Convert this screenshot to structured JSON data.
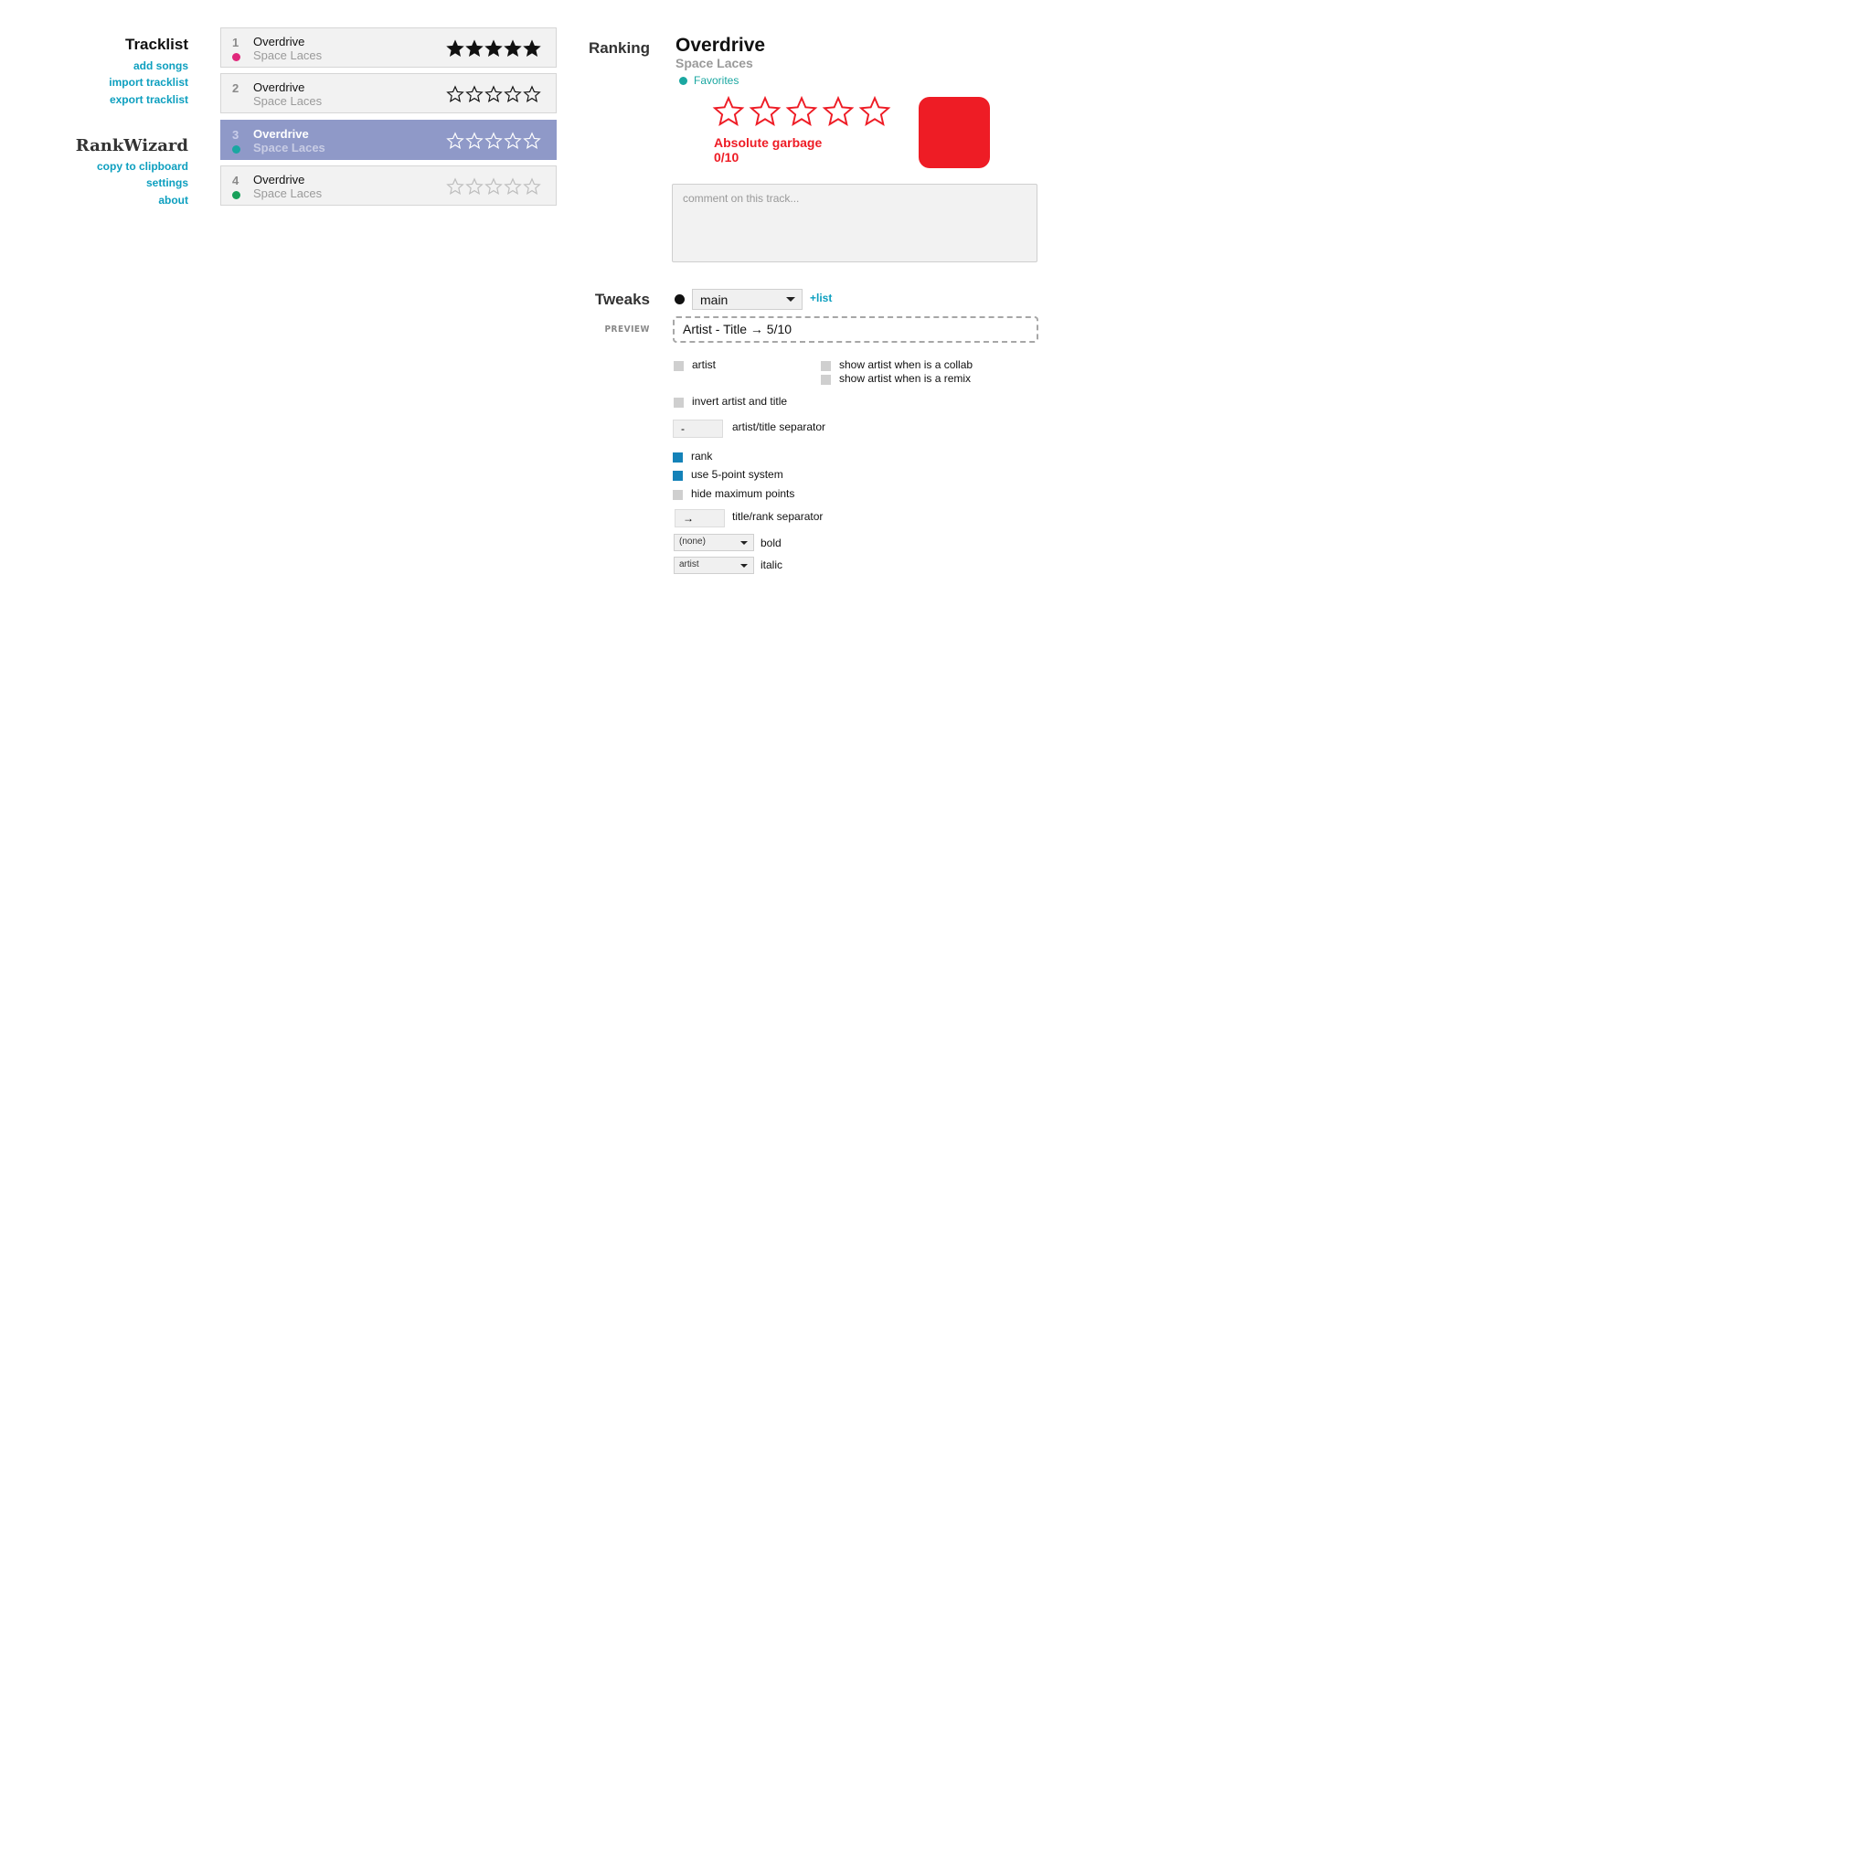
{
  "sidebar": {
    "tracklist_title": "Tracklist",
    "tracklist_links": [
      "add songs",
      "import tracklist",
      "export tracklist"
    ],
    "app_name": "RankWizard",
    "app_links": [
      "copy to clipboard",
      "settings",
      "about"
    ]
  },
  "tracks": [
    {
      "num": "1",
      "title": "Overdrive",
      "artist": "Space Laces",
      "dot_color": "#e0277b",
      "stars_filled": 5,
      "star_style": "filled"
    },
    {
      "num": "2",
      "title": "Overdrive",
      "artist": "Space Laces",
      "dot_color": "",
      "stars_filled": 0,
      "star_style": "outline"
    },
    {
      "num": "3",
      "title": "Overdrive",
      "artist": "Space Laces",
      "dot_color": "#1aa7a1",
      "stars_filled": 0,
      "star_style": "white-outline",
      "selected": true
    },
    {
      "num": "4",
      "title": "Overdrive",
      "artist": "Space Laces",
      "dot_color": "#18a05a",
      "stars_filled": 0,
      "star_style": "faint"
    }
  ],
  "ranking": {
    "label": "Ranking",
    "title": "Overdrive",
    "artist": "Space Laces",
    "list_name": "Favorites",
    "list_color": "#1aa7a1",
    "stars_total": 5,
    "stars_filled": 0,
    "verdict": "Absolute garbage",
    "score": "0/10",
    "accent_color": "#ee1c25",
    "comment_placeholder": "comment on this track..."
  },
  "tweaks": {
    "label": "Tweaks",
    "list_select": "main",
    "add_list": "+list",
    "preview_label": "PREVIEW",
    "preview_text": "Artist - Title → 5/10",
    "options": {
      "artist": {
        "label": "artist",
        "checked": false
      },
      "collab": {
        "label": "show artist when is a collab",
        "checked": false
      },
      "remix": {
        "label": "show artist when is a remix",
        "checked": false
      },
      "invert": {
        "label": "invert artist and title",
        "checked": false
      },
      "artist_sep_value": "-",
      "artist_sep_label": "artist/title separator",
      "rank": {
        "label": "rank",
        "checked": true
      },
      "five_point": {
        "label": "use 5-point system",
        "checked": true
      },
      "hide_max": {
        "label": "hide maximum points",
        "checked": false
      },
      "rank_sep_value": "→",
      "rank_sep_label": "title/rank separator",
      "bold_value": "(none)",
      "bold_label": "bold",
      "italic_value": "artist",
      "italic_label": "italic"
    }
  }
}
